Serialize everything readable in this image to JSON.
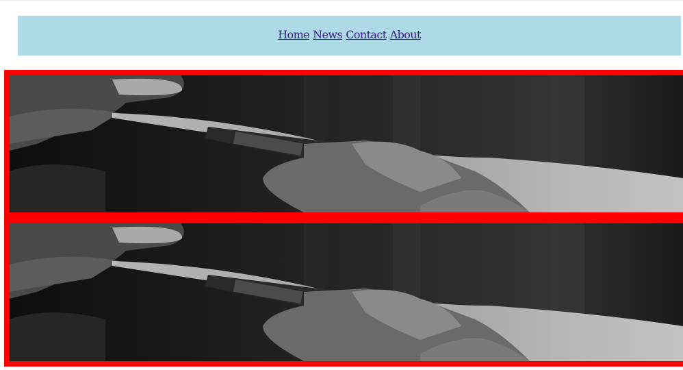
{
  "nav": {
    "links": [
      {
        "label": "Home"
      },
      {
        "label": "News"
      },
      {
        "label": "Contact"
      },
      {
        "label": "About"
      }
    ]
  },
  "banners": [
    {
      "image": "vaping-photo"
    },
    {
      "image": "vaping-photo"
    }
  ],
  "colors": {
    "nav_background": "#add8e6",
    "banner_border": "#ff0000",
    "link": "#3b1a8a"
  }
}
